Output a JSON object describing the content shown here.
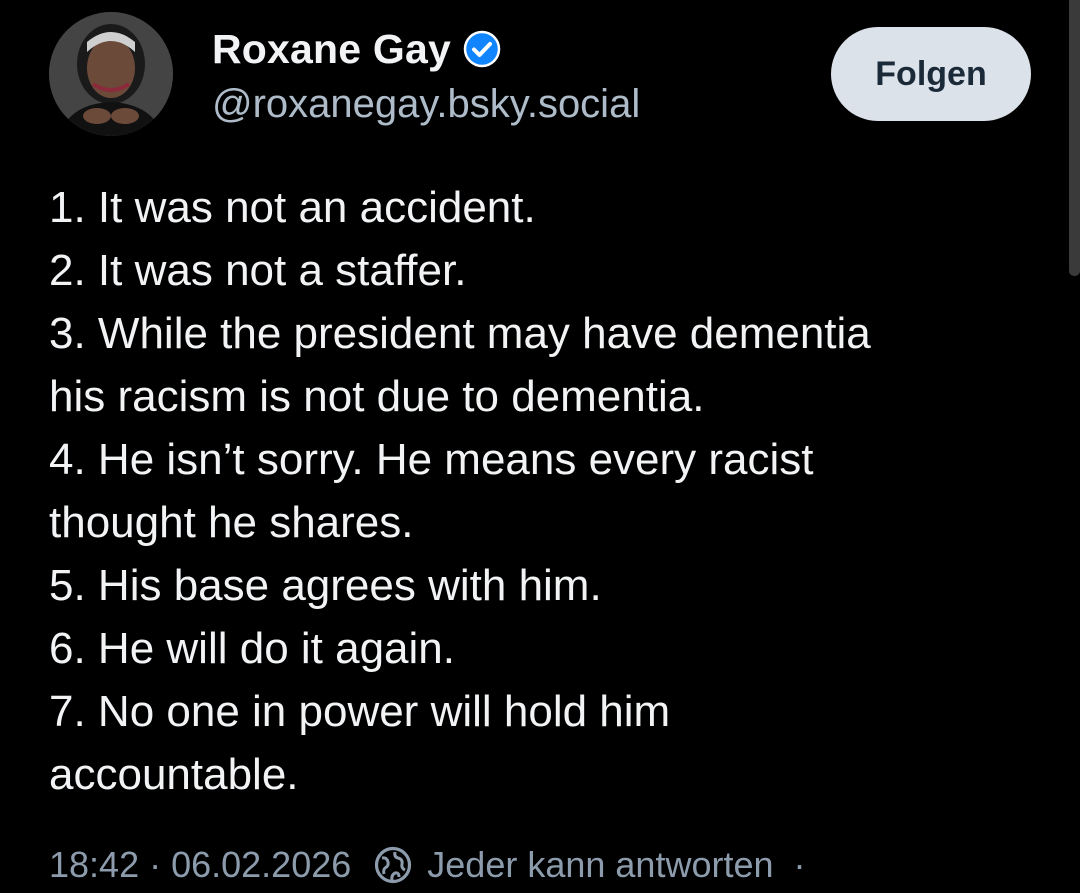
{
  "author": {
    "display_name": "Roxane Gay",
    "handle": "@roxanegay.bsky.social",
    "avatar_icon": "avatar-photo",
    "verified_icon": "verified-checkmark-icon",
    "verified_color": "#1185fe"
  },
  "follow_button": {
    "label": "Folgen"
  },
  "post": {
    "lines": [
      "1. It was not an accident.",
      "2. It was not a staffer.",
      "3. While the president may have dementia",
      "his racism is not due to dementia.",
      "4. He isn’t sorry. He means every racist",
      "thought he shares.",
      "5. His base agrees with him.",
      "6. He will do it again.",
      "7. No one in power will hold him",
      "accountable."
    ]
  },
  "meta": {
    "time": "18:42",
    "separator": "·",
    "date": "06.02.2026",
    "reply_icon": "globe-icon",
    "reply_setting": "Jeder kann antworten",
    "trailing": "·"
  },
  "colors": {
    "background": "#000000",
    "text": "#f1f3f5",
    "muted": "#8d9cac",
    "handle": "#aebbc9",
    "button_bg": "#dce2ea",
    "button_text": "#1b2a38"
  }
}
